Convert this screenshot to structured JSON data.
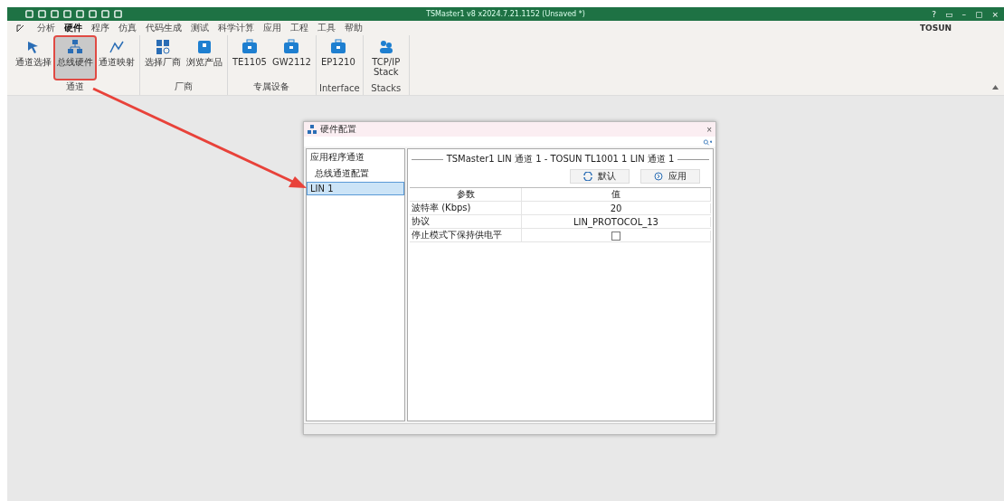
{
  "window": {
    "title": "TSMaster1 v8 x2024.7.21.1152 (Unsaved *)",
    "brand": "TOSUN",
    "controls": [
      "?",
      "▭",
      "–",
      "▢",
      "×"
    ]
  },
  "menu": [
    {
      "label": "分析",
      "selected": false
    },
    {
      "label": "硬件",
      "selected": true
    },
    {
      "label": "程序",
      "selected": false
    },
    {
      "label": "仿真",
      "selected": false
    },
    {
      "label": "代码生成",
      "selected": false
    },
    {
      "label": "测试",
      "selected": false
    },
    {
      "label": "科学计算",
      "selected": false
    },
    {
      "label": "应用",
      "selected": false
    },
    {
      "label": "工程",
      "selected": false
    },
    {
      "label": "工具",
      "selected": false
    },
    {
      "label": "帮助",
      "selected": false
    }
  ],
  "ribbon": [
    {
      "group": "通道",
      "buttons": [
        {
          "label": "通道选择",
          "selected": false
        },
        {
          "label": "总线硬件",
          "selected": true
        },
        {
          "label": "通道映射",
          "selected": false
        }
      ]
    },
    {
      "group": "厂商",
      "buttons": [
        {
          "label": "选择厂商",
          "selected": false
        },
        {
          "label": "浏览产品",
          "selected": false
        }
      ]
    },
    {
      "group": "专属设备",
      "buttons": [
        {
          "label": "TE1105",
          "selected": false
        },
        {
          "label": "GW2112",
          "selected": false
        }
      ]
    },
    {
      "group": "Interface",
      "buttons": [
        {
          "label": "EP1210",
          "selected": false
        }
      ]
    },
    {
      "group": "Stacks",
      "buttons": [
        {
          "label": "TCP/IP Stack",
          "selected": false
        }
      ]
    }
  ],
  "dialog": {
    "title": "硬件配置",
    "close": "×",
    "tree": [
      {
        "label": "应用程序通道",
        "selected": false,
        "children": [
          {
            "label": "总线通道配置",
            "selected": false
          }
        ]
      },
      {
        "label": "LIN 1",
        "selected": true
      }
    ],
    "header": "TSMaster1 LIN 通道 1 - TOSUN TL1001 1 LIN 通道 1",
    "buttons": [
      {
        "label": "默认"
      },
      {
        "label": "应用"
      }
    ],
    "table": {
      "columns": [
        "参数",
        "值"
      ],
      "rows": [
        {
          "kind": "text",
          "name": "波特率 (Kbps)",
          "value": "20"
        },
        {
          "kind": "text",
          "name": "协议",
          "value": "LIN_PROTOCOL_13"
        },
        {
          "kind": "checkbox",
          "name": "停止模式下保持供电平",
          "checked": false
        }
      ]
    }
  }
}
